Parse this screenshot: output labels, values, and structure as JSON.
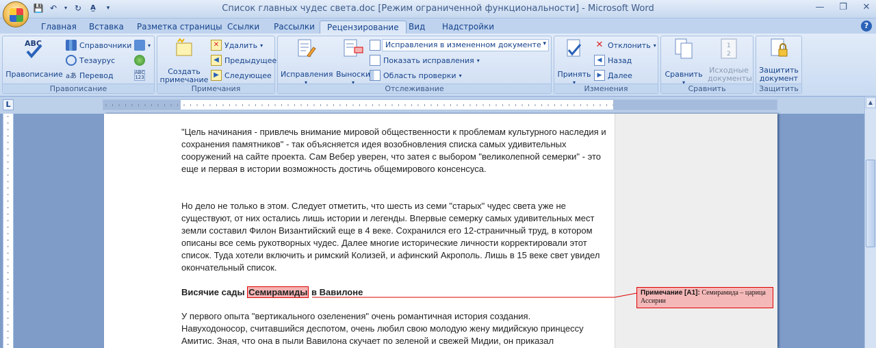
{
  "window": {
    "title": "Список главных чудес света.doc [Режим ограниченной функциональности] - Microsoft Word"
  },
  "tabs": [
    {
      "label": "Главная"
    },
    {
      "label": "Вставка"
    },
    {
      "label": "Разметка страницы"
    },
    {
      "label": "Ссылки"
    },
    {
      "label": "Рассылки"
    },
    {
      "label": "Рецензирование",
      "active": true
    },
    {
      "label": "Вид"
    },
    {
      "label": "Надстройки"
    }
  ],
  "ribbon": {
    "spelling": {
      "label": "Правописание",
      "spelling_btn": "Правописание",
      "references": "Справочники",
      "thesaurus": "Тезаурус",
      "translate": "Перевод"
    },
    "comments": {
      "label": "Примечания",
      "create": "Создать примечание",
      "delete": "Удалить",
      "previous": "Предыдущее",
      "next": "Следующее"
    },
    "tracking": {
      "label": "Отслеживание",
      "track_changes": "Исправления",
      "balloons": "Выноски",
      "display_mode": "Исправления в измененном документе",
      "show_markup": "Показать исправления",
      "reviewing_pane": "Область проверки"
    },
    "changes": {
      "label": "Изменения",
      "accept": "Принять",
      "reject": "Отклонить",
      "back": "Назад",
      "forward": "Далее"
    },
    "compare": {
      "label": "Сравнить",
      "compare_btn": "Сравнить",
      "source_docs": "Исходные документы"
    },
    "protect": {
      "label": "Защитить",
      "protect_btn": "Защитить документ"
    }
  },
  "document": {
    "p1": "\"Цель начинания  - привлечь внимание  мировой общественности к проблемам культурного наследия и сохранения памятников\" - так объясняется идея возобновления списка самых удивительных сооружений на сайте проекта. Сам Вебер уверен, что затея с выбором \"великолепной семерки\" - это еще  и первая в истории возможность достичь общемирового консенсуса.",
    "p2": "Но дело не только в этом. Следует отметить, что шесть  из семи \"старых\" чудес света уже не существуют, от них остались лишь истории и легенды. Впервые семерку самых удивительных мест земли составил Филон Византийский  еще в 4 веке. Сохранился его 12-страничный  труд, в котором описаны все семь рукотворных чудес. Далее многие исторические личности корректировали этот список. Туда хотели включить и римский Колизей, и афинский Акрополь. Лишь в 15 веке свет увидел окончательный  список.",
    "heading_pre": "Висячие сады ",
    "heading_mark": "Семирамиды",
    "heading_post": " в Вавилоне",
    "p3_line1": "У первого опыта \"вертикального озеленения\"  очень романтичная  история создания.",
    "p3_line2": "Навуходоносор, считавшийся деспотом, очень любил свою молодую жену мидийскую принцессу",
    "p3_line3": "Амитис. Зная,  что она в пыли Вавилона  скучает по зеленой и свежей Мидии,  он приказал"
  },
  "comment": {
    "label": "Примечание [A1]:",
    "text": "Семирамида – царица Ассирии"
  }
}
